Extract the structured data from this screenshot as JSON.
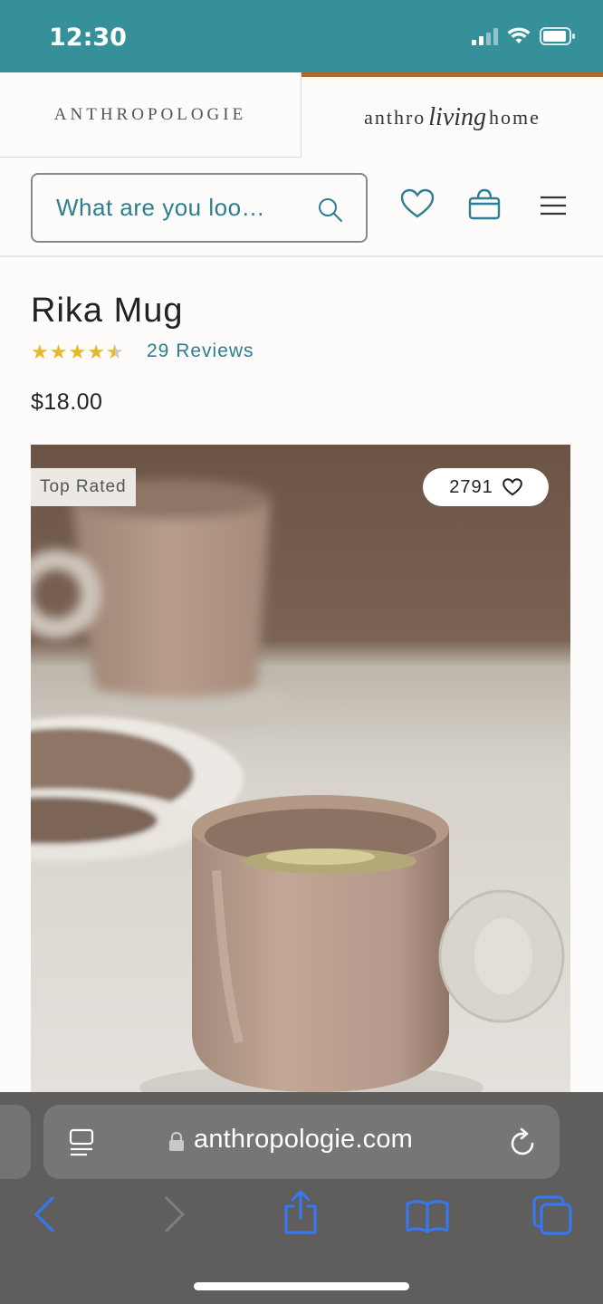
{
  "status_bar": {
    "time": "12:30"
  },
  "brand_tabs": {
    "left_label": "ANTHROPOLOGIE",
    "right_label_pre": "anthro",
    "right_label_script": "living",
    "right_label_post": "home"
  },
  "header": {
    "search_placeholder": "What are you loo…"
  },
  "product": {
    "title": "Rika Mug",
    "rating": 4.5,
    "reviews_label": "29 Reviews",
    "price": "$18.00",
    "badge": "Top Rated",
    "favorites_count": "2791"
  },
  "browser": {
    "url": "anthropologie.com"
  },
  "colors": {
    "status_bar": "#35909a",
    "link": "#2c7e90",
    "accent_tab": "#b0682b",
    "safari_icons": "#3478f6"
  },
  "icons": [
    "wifi-icon",
    "battery-icon",
    "search-icon",
    "heart-icon",
    "bag-icon",
    "menu-icon",
    "lock-icon",
    "reader-icon",
    "reload-icon",
    "back-icon",
    "forward-icon",
    "share-icon",
    "bookmarks-icon",
    "tabs-icon"
  ]
}
